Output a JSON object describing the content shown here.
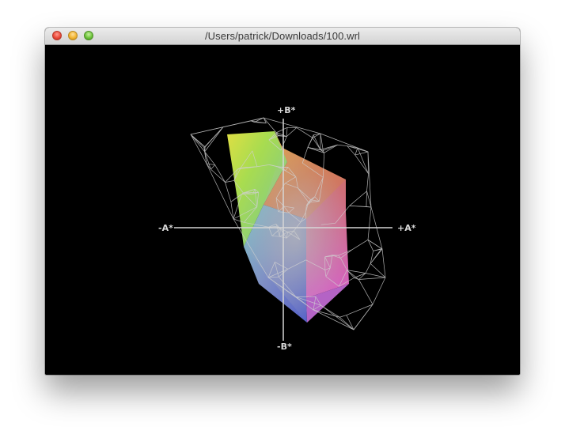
{
  "window": {
    "title": "/Users/patrick/Downloads/100.wrl",
    "controls": {
      "close_icon": "close-icon",
      "minimize_icon": "minimize-icon",
      "zoom_icon": "zoom-icon"
    }
  },
  "viewer": {
    "background": "#000000",
    "wireframe_color": "#d0d0d0",
    "axes": {
      "plus_b": "+B*",
      "minus_b": "-B*",
      "plus_a": "+A*",
      "minus_a": "-A*"
    }
  }
}
